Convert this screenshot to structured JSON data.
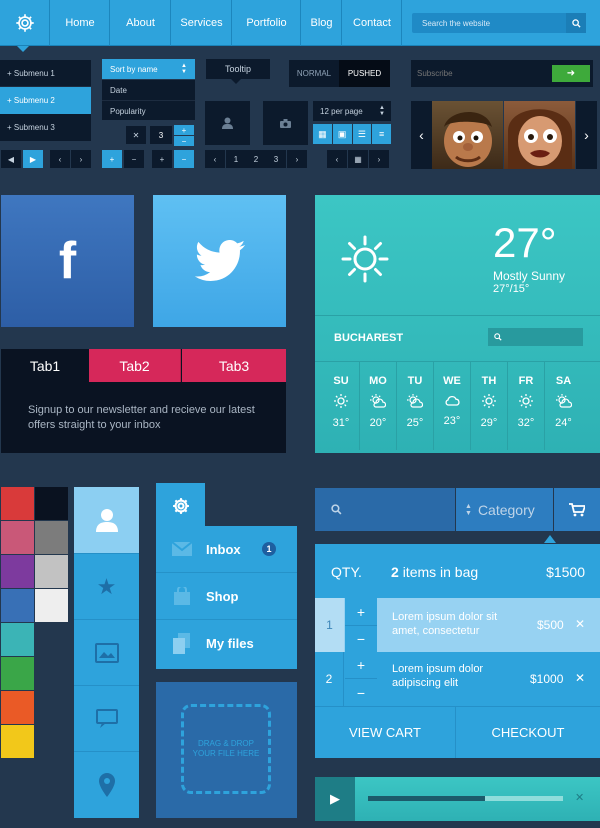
{
  "nav": {
    "items": [
      "Home",
      "About",
      "Services",
      "Portfolio",
      "Blog",
      "Contact"
    ],
    "search_placeholder": "Search the website"
  },
  "submenu": [
    "+ Submenu 1",
    "+ Submenu 2",
    "+ Submenu 3"
  ],
  "sort": {
    "selected": "Sort by name",
    "options": [
      "Date",
      "Popularity"
    ]
  },
  "tooltip": "Tooltip",
  "toggle": {
    "normal": "NORMAL",
    "pushed": "PUSHED"
  },
  "subscribe": {
    "placeholder": "Subscribe"
  },
  "per_page": "12 per page",
  "stepper_value": "3",
  "pagination": [
    "1",
    "2",
    "3"
  ],
  "tabs": {
    "labels": [
      "Tab1",
      "Tab2",
      "Tab3"
    ],
    "content": "Signup to our newsletter and recieve our latest offers straight to your inbox"
  },
  "weather": {
    "temp": "27°",
    "condition": "Mostly Sunny",
    "range": "27°/15°",
    "city": "BUCHAREST",
    "days": [
      {
        "day": "SU",
        "temp": "31°",
        "icon": "sun"
      },
      {
        "day": "MO",
        "temp": "20°",
        "icon": "cloud-sun"
      },
      {
        "day": "TU",
        "temp": "25°",
        "icon": "cloud-sun"
      },
      {
        "day": "WE",
        "temp": "23°",
        "icon": "cloud"
      },
      {
        "day": "TH",
        "temp": "29°",
        "icon": "sun"
      },
      {
        "day": "FR",
        "temp": "32°",
        "icon": "sun"
      },
      {
        "day": "SA",
        "temp": "24°",
        "icon": "cloud-sun"
      }
    ]
  },
  "menu": {
    "items": [
      {
        "label": "Inbox",
        "badge": "1",
        "icon": "mail"
      },
      {
        "label": "Shop",
        "icon": "bag"
      },
      {
        "label": "My files",
        "icon": "files"
      }
    ],
    "dropzone": "DRAG & DROP YOUR FILE HERE"
  },
  "cart": {
    "category": "Category",
    "qty_label": "QTY.",
    "items_count": "2",
    "items_suffix": "items in bag",
    "total": "$1500",
    "items": [
      {
        "qty": "1",
        "text": "Lorem ipsum dolor sit amet, consectetur",
        "price": "$500"
      },
      {
        "qty": "2",
        "text": "Lorem ipsum dolor adipiscing elit",
        "price": "$1000"
      }
    ],
    "view_cart": "VIEW CART",
    "checkout": "CHECKOUT"
  },
  "player": {
    "progress": 0.6
  },
  "colors": {
    "accent": "#2ea3dc",
    "dark": "#0c1a2c",
    "pink": "#d6285a",
    "teal": "#3cc6c4",
    "swatches_left": [
      "#d93a3a",
      "#c95878",
      "#7d3a9e",
      "#3870b6",
      "#3bb4b6",
      "#3aa648",
      "#ea5a26",
      "#f2c81a"
    ],
    "swatches_right": [
      "#0a1220",
      "#7c7c7c",
      "#c2c2c2",
      "#eeeeee"
    ]
  }
}
